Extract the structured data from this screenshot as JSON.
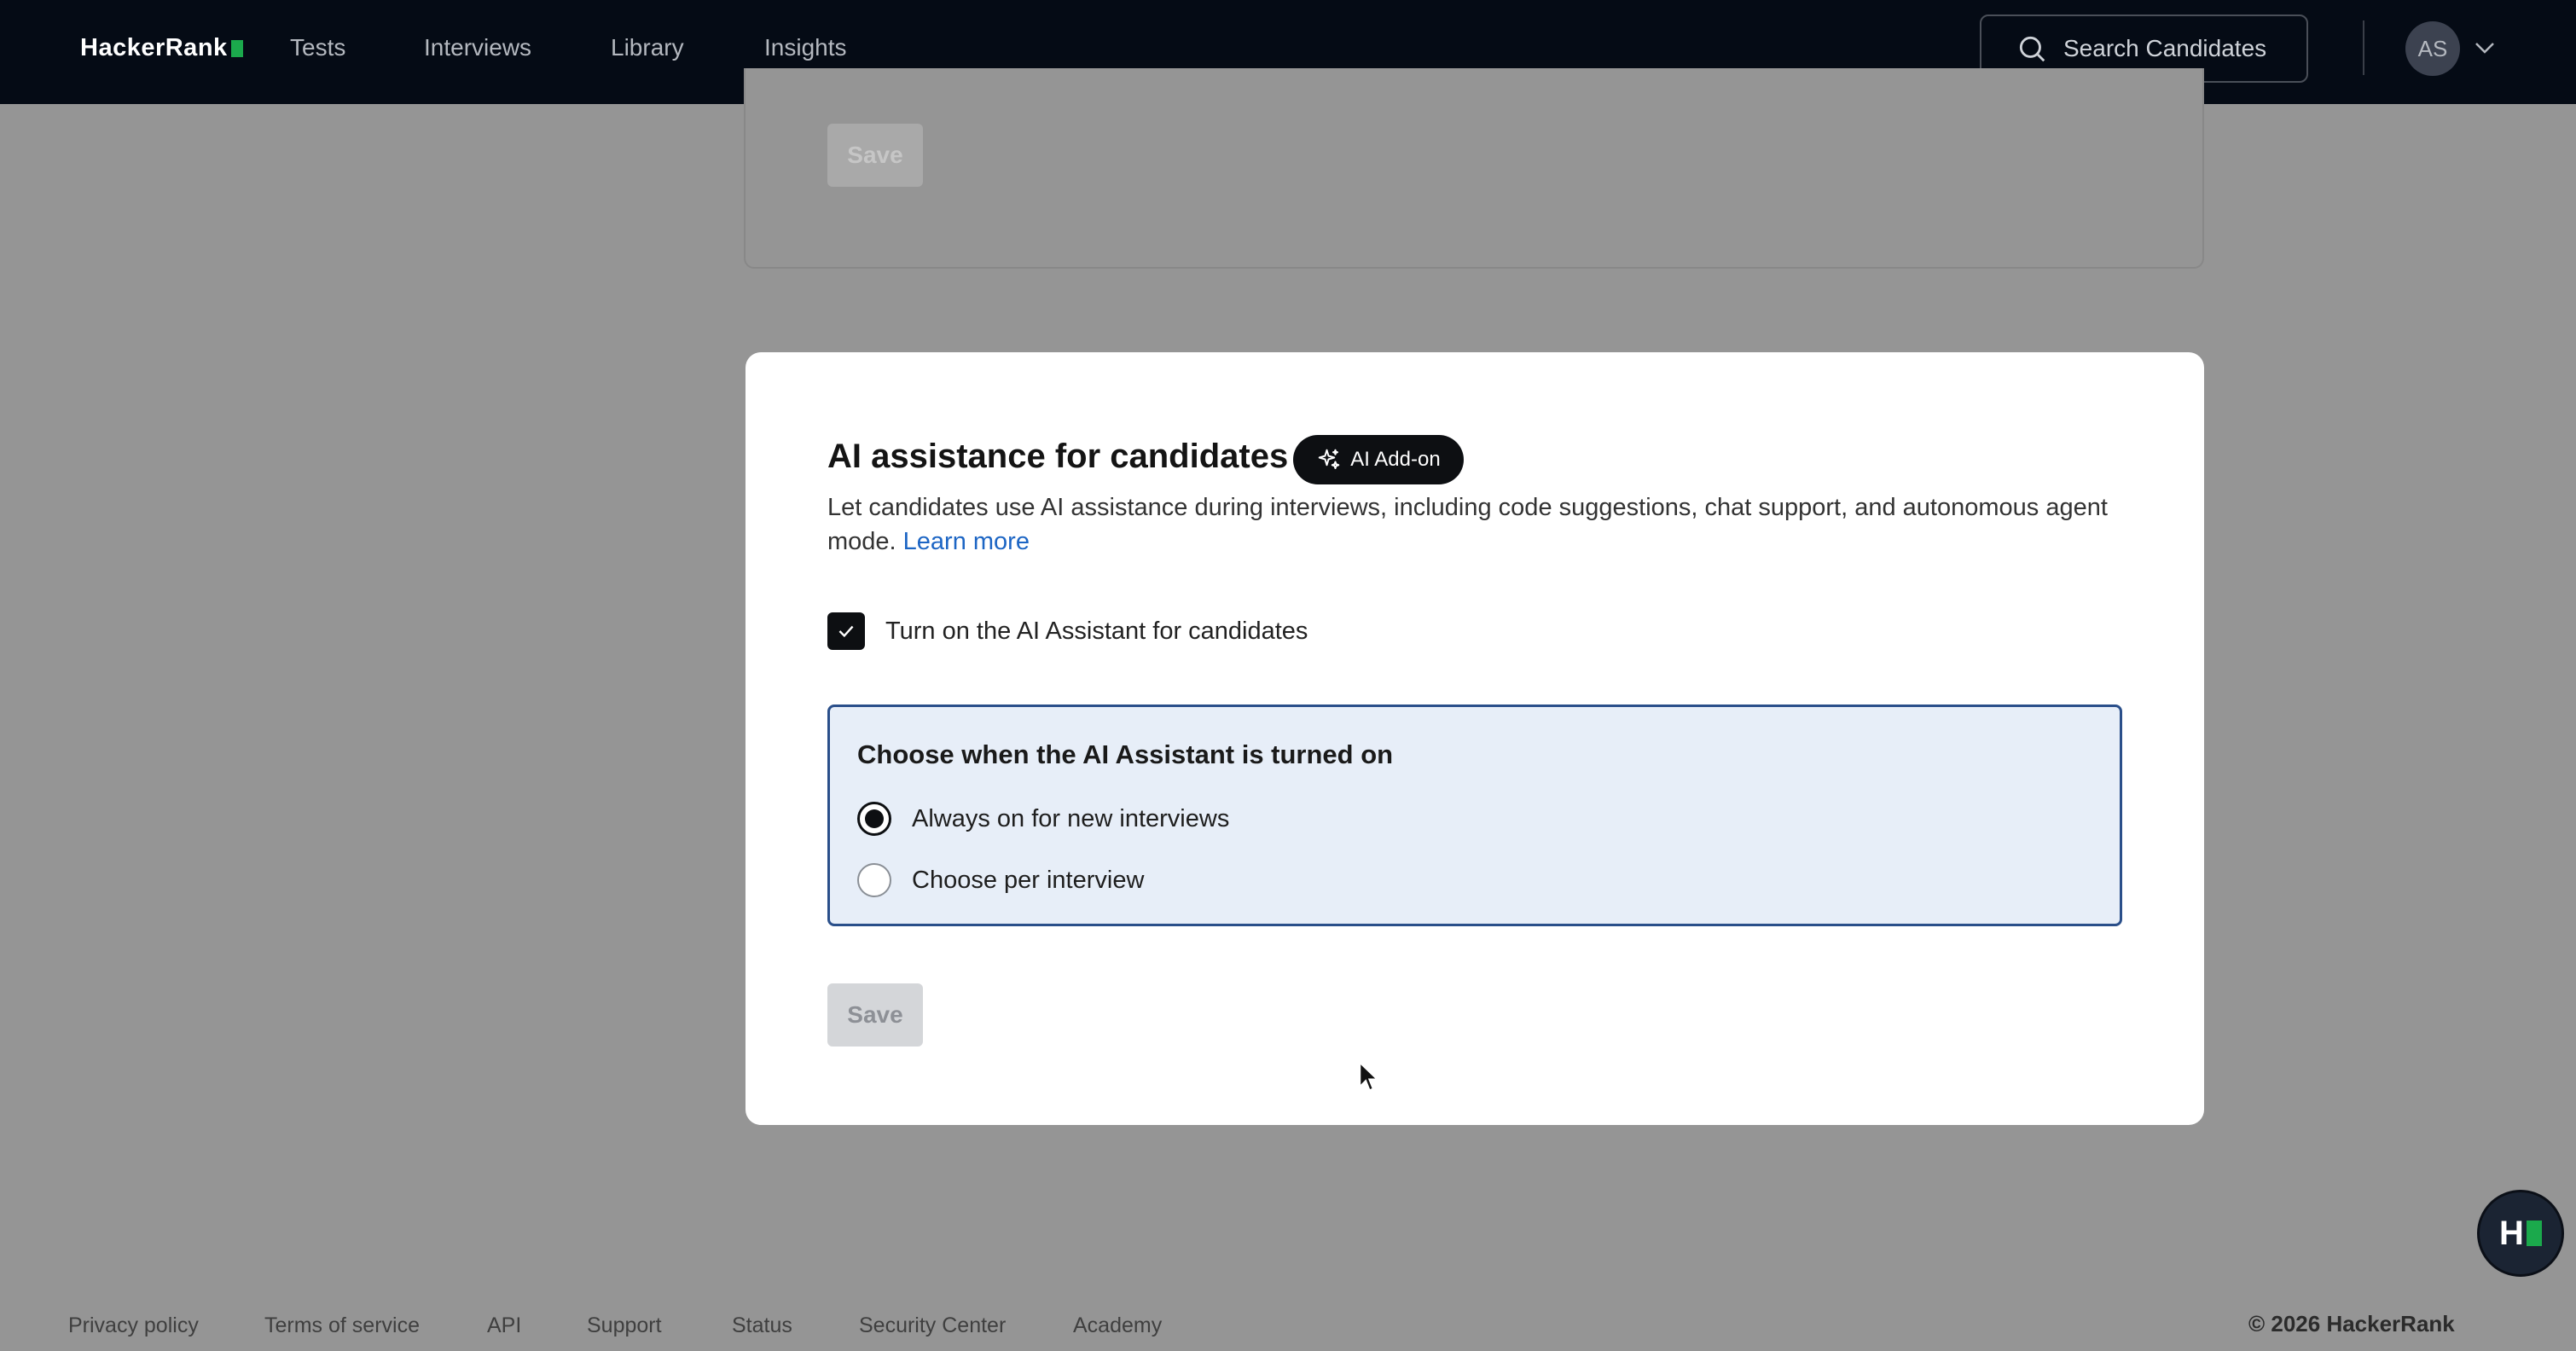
{
  "nav": {
    "logo_text": "HackerRank",
    "links": [
      "Tests",
      "Interviews",
      "Library",
      "Insights"
    ],
    "search_label": "Search Candidates",
    "avatar_initials": "AS"
  },
  "background_card": {
    "save_label": "Save"
  },
  "modal": {
    "title": "AI assistance for candidates",
    "badge_label": "AI Add-on",
    "description": "Let candidates use AI assistance during interviews, including code suggestions, chat support, and autonomous agent mode.",
    "learn_more": "Learn more",
    "checkbox_label": "Turn on the AI Assistant for candidates",
    "checkbox_checked": true,
    "choice_title": "Choose when the AI Assistant is turned on",
    "options": [
      {
        "label": "Always on for new interviews",
        "selected": true
      },
      {
        "label": "Choose per interview",
        "selected": false
      }
    ],
    "save_label": "Save"
  },
  "help_bubble_label": "H",
  "footer": {
    "links": [
      "Privacy policy",
      "Terms of service",
      "API",
      "Support",
      "Status",
      "Security Center",
      "Academy"
    ],
    "copyright": "© 2026 HackerRank"
  },
  "colors": {
    "nav_bg": "#050b15",
    "brand_green": "#1ba94c",
    "link_blue": "#1c65c4",
    "panel_border": "#2a4f8a",
    "panel_bg": "#e7eef8"
  }
}
